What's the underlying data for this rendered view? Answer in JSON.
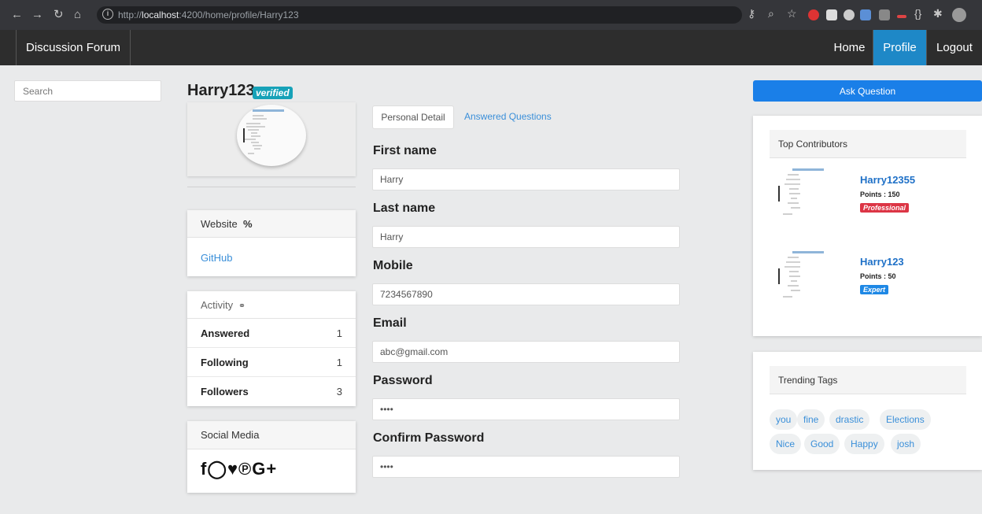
{
  "browser": {
    "url_prefix": "http://",
    "url_host": "localhost",
    "url_rest": ":4200/home/profile/Harry123"
  },
  "navbar": {
    "brand": "Discussion Forum",
    "items": [
      {
        "label": "Home"
      },
      {
        "label": "Profile",
        "active": true
      },
      {
        "label": "Logout"
      }
    ]
  },
  "search": {
    "placeholder": "Search"
  },
  "profile": {
    "username": "Harry123",
    "verified_label": "verified"
  },
  "website": {
    "heading": "Website",
    "link_label": "GitHub"
  },
  "activity": {
    "heading": "Activity",
    "rows": [
      {
        "label": "Answered",
        "count": "1"
      },
      {
        "label": "Following",
        "count": "1"
      },
      {
        "label": "Followers",
        "count": "3"
      }
    ]
  },
  "social": {
    "heading": "Social Media",
    "icons": [
      "facebook-icon",
      "instagram-icon",
      "twitter-icon",
      "pinterest-icon",
      "google-plus-icon"
    ]
  },
  "tabs": [
    {
      "label": "Personal Detail",
      "active": true
    },
    {
      "label": "Answered Questions"
    }
  ],
  "form": {
    "first_name": {
      "label": "First name",
      "value": "Harry"
    },
    "last_name": {
      "label": "Last name",
      "value": "Harry"
    },
    "mobile": {
      "label": "Mobile",
      "value": "7234567890"
    },
    "email": {
      "label": "Email",
      "value": "abc@gmail.com"
    },
    "password": {
      "label": "Password",
      "value": "••••"
    },
    "confirm_password": {
      "label": "Confirm Password",
      "value": "••••"
    }
  },
  "ask_button": "Ask Question",
  "top_contributors": {
    "heading": "Top Contributors",
    "items": [
      {
        "name": "Harry12355",
        "points": "Points : 150",
        "badge": "Professional"
      },
      {
        "name": "Harry123",
        "points": "Points : 50",
        "badge": "Expert"
      }
    ]
  },
  "trending": {
    "heading": "Trending Tags",
    "tags": [
      "you",
      "fine",
      "drastic",
      "Elections",
      "Nice",
      "Good",
      "Happy",
      "josh"
    ]
  },
  "colors": {
    "navbar": "#2d2d2d",
    "active_nav": "#1e88c7",
    "ask_button": "#1a7fe8",
    "verified_badge": "#17a2b8",
    "professional_badge": "#dc3545",
    "expert_badge": "#1e88e5",
    "link": "#3a8fd9"
  }
}
